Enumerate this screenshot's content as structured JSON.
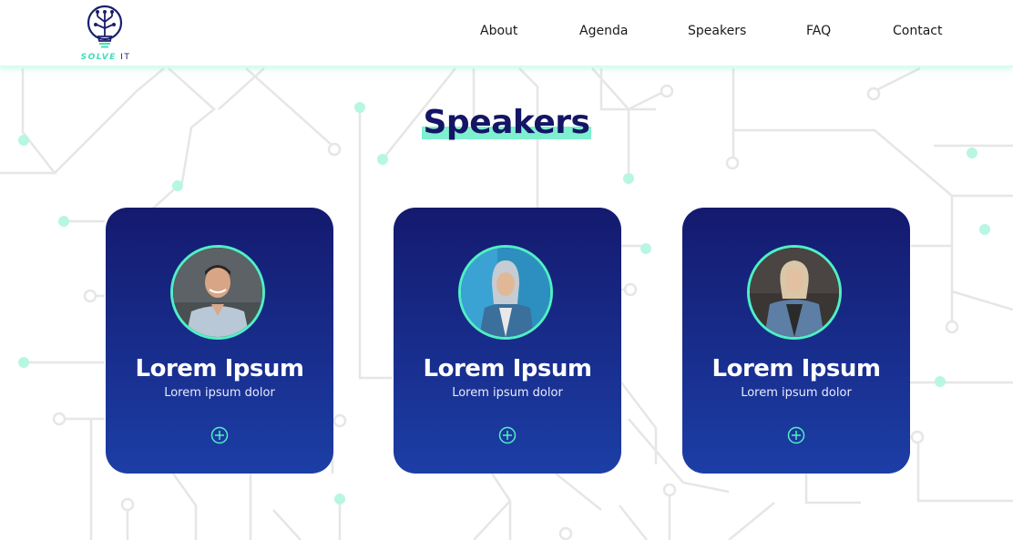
{
  "brand": {
    "logo_word1": "SOLVE",
    "logo_word2": "IT"
  },
  "nav": {
    "items": [
      {
        "label": "About"
      },
      {
        "label": "Agenda"
      },
      {
        "label": "Speakers"
      },
      {
        "label": "FAQ"
      },
      {
        "label": "Contact"
      }
    ]
  },
  "section": {
    "title": "Speakers"
  },
  "speakers": [
    {
      "name": "Lorem Ipsum",
      "role": "Lorem ipsum dolor"
    },
    {
      "name": "Lorem Ipsum",
      "role": "Lorem ipsum dolor"
    },
    {
      "name": "Lorem Ipsum",
      "role": "Lorem ipsum dolor"
    }
  ],
  "icons": {
    "logo": "lightbulb-circuit-icon",
    "expand": "plus-circle-icon"
  },
  "colors": {
    "accent": "#4ff0c4",
    "navy": "#141565",
    "card_top": "#141a6e",
    "card_bottom": "#1c3ea6",
    "circuit_line": "#e6e6e6",
    "circuit_node": "#c9f6e8"
  }
}
